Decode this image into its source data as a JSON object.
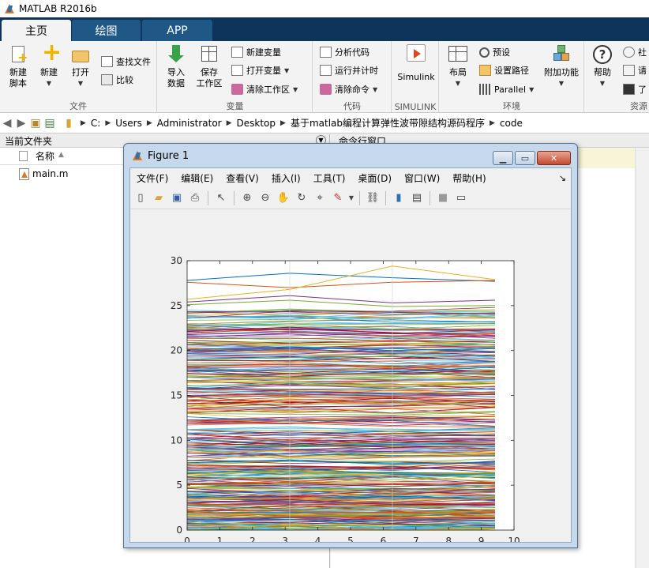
{
  "app": {
    "title": "MATLAB R2016b"
  },
  "tabs": [
    {
      "label": "主页",
      "active": true
    },
    {
      "label": "绘图",
      "active": false
    },
    {
      "label": "APP",
      "active": false
    }
  ],
  "ribbon": {
    "file": {
      "label": "文件",
      "new_script": "新建\n脚本",
      "new": "新建",
      "open": "打开",
      "find_files": "查找文件",
      "compare": "比较"
    },
    "variable": {
      "label": "变量",
      "import": "导入\n数据",
      "save_ws": "保存\n工作区",
      "new_var": "新建变量",
      "open_var": "打开变量",
      "clear_ws": "清除工作区"
    },
    "code": {
      "label": "代码",
      "analyze": "分析代码",
      "run_time": "运行并计时",
      "clear_cmds": "清除命令"
    },
    "simulink": {
      "label": "SIMULINK",
      "button": "Simulink"
    },
    "environment": {
      "label": "环境",
      "layout": "布局",
      "prefs": "预设",
      "set_path": "设置路径",
      "parallel": "Parallel",
      "addons": "附加功能"
    },
    "resources": {
      "label": "资源",
      "help": "帮助",
      "community": "社",
      "request": "请",
      "learn": "了"
    }
  },
  "address": {
    "crumbs": [
      "C:",
      "Users",
      "Administrator",
      "Desktop",
      "基于matlab编程计算弹性波带隙结构源码程序",
      "code"
    ]
  },
  "left_panel": {
    "title": "当前文件夹",
    "column_name": "名称",
    "files": [
      "main.m"
    ]
  },
  "right_panel": {
    "title": "命令行窗口"
  },
  "figure": {
    "title": "Figure 1",
    "menu": [
      "文件(F)",
      "编辑(E)",
      "查看(V)",
      "插入(I)",
      "工具(T)",
      "桌面(D)",
      "窗口(W)",
      "帮助(H)"
    ],
    "corner_glyph": "↘"
  },
  "chart_data": {
    "type": "line",
    "title": "",
    "xlabel": "",
    "ylabel": "",
    "xlim": [
      0,
      10
    ],
    "ylim": [
      0,
      30
    ],
    "xticks": [
      0,
      1,
      2,
      3,
      4,
      5,
      6,
      7,
      8,
      9,
      10
    ],
    "yticks": [
      0,
      5,
      10,
      15,
      20,
      25,
      30
    ],
    "x": [
      0,
      3.14,
      6.28,
      9.42
    ],
    "grid": false,
    "note_series": "band dispersion curves; approximately 400 nearly flat lines spanning 0–29.5",
    "series": [
      {
        "values": [
          27.8,
          28.6,
          28.1,
          27.7
        ]
      },
      {
        "values": [
          27.6,
          27.0,
          27.6,
          27.8
        ]
      },
      {
        "values": [
          25.7,
          26.8,
          29.4,
          27.9
        ]
      },
      {
        "values": [
          25.4,
          26.1,
          25.3,
          25.6
        ]
      },
      {
        "values": [
          25.1,
          25.6,
          24.9,
          25.0
        ]
      },
      {
        "values": [
          23.6,
          23.9,
          23.5,
          24.0
        ]
      },
      {
        "values": [
          22.1,
          22.6,
          21.9,
          22.3
        ]
      },
      {
        "values": [
          20.1,
          20.4,
          20.0,
          20.2
        ]
      },
      {
        "values": [
          18.2,
          18.5,
          18.0,
          18.3
        ]
      },
      {
        "values": [
          16.4,
          16.6,
          16.2,
          16.5
        ]
      },
      {
        "values": [
          15.0,
          15.2,
          14.9,
          15.1
        ]
      },
      {
        "values": [
          13.1,
          13.3,
          13.0,
          13.2
        ]
      },
      {
        "values": [
          11.2,
          11.5,
          11.0,
          11.3
        ]
      },
      {
        "values": [
          9.4,
          9.7,
          9.2,
          9.5
        ]
      },
      {
        "values": [
          7.5,
          7.8,
          7.3,
          7.6
        ]
      },
      {
        "values": [
          5.2,
          5.4,
          5.1,
          5.3
        ]
      },
      {
        "values": [
          3.4,
          3.6,
          3.3,
          3.5
        ]
      },
      {
        "values": [
          1.2,
          1.4,
          1.1,
          1.3
        ]
      },
      {
        "values": [
          0.0,
          0.4,
          0.6,
          0.2
        ]
      }
    ]
  },
  "colors": {
    "tab_bg": "#0e3559",
    "line_palette": [
      "#0072bd",
      "#d95319",
      "#edb120",
      "#7e2f8e",
      "#77ac30",
      "#4dbeee",
      "#a2142f"
    ]
  }
}
